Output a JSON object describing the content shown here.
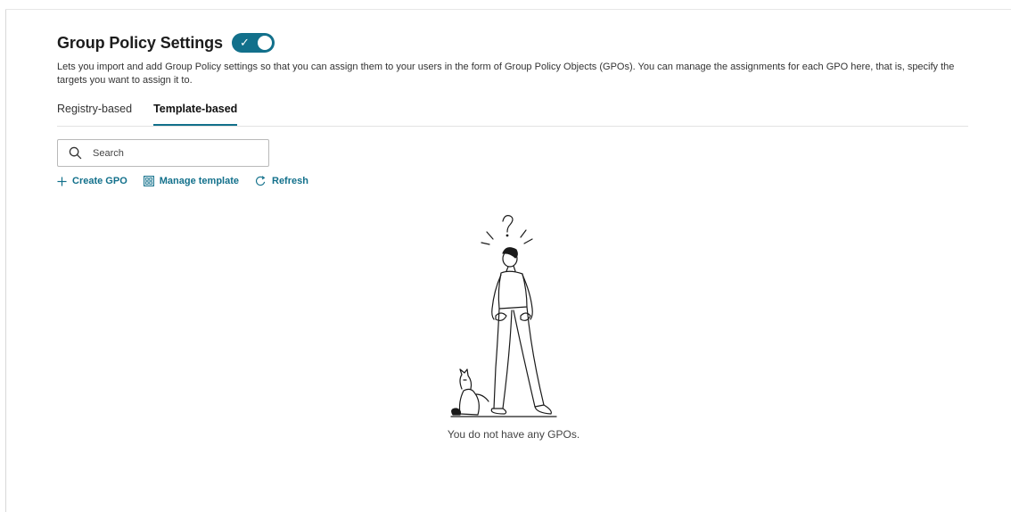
{
  "header": {
    "title": "Group Policy Settings",
    "toggle_state": "on",
    "description": "Lets you import and add Group Policy settings so that you can assign them to your users in the form of Group Policy Objects (GPOs). You can manage the assignments for each GPO here, that is, specify the targets you want to assign it to."
  },
  "tabs": [
    {
      "label": "Registry-based",
      "active": false
    },
    {
      "label": "Template-based",
      "active": true
    }
  ],
  "search": {
    "placeholder": "Search",
    "value": ""
  },
  "actions": {
    "create": "Create GPO",
    "manage": "Manage template",
    "refresh": "Refresh"
  },
  "empty_state": {
    "message": "You do not have any GPOs.",
    "illustration": "confused-person-empty-pockets-with-cat"
  },
  "colors": {
    "accent": "#12708b",
    "text": "#1f1f1f"
  },
  "icons": {
    "search": "search-icon",
    "create": "plus-icon",
    "manage": "template-icon",
    "refresh": "refresh-icon",
    "toggle": "check-icon"
  }
}
